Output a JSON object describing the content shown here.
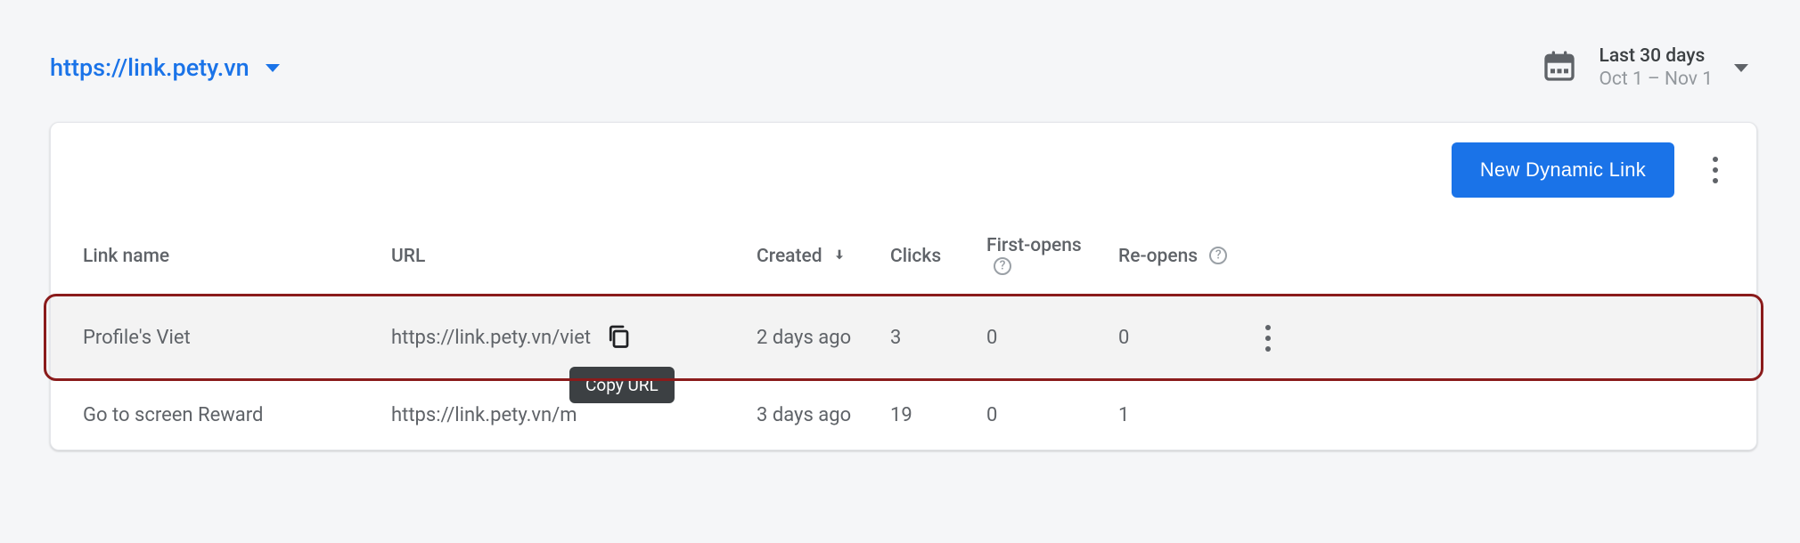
{
  "header": {
    "domain_label": "https://link.pety.vn",
    "date_range": {
      "label": "Last 30 days",
      "range": "Oct 1 – Nov 1"
    }
  },
  "toolbar": {
    "new_link_label": "New Dynamic Link"
  },
  "columns": {
    "name": "Link name",
    "url": "URL",
    "created": "Created",
    "clicks": "Clicks",
    "first_opens": "First-opens",
    "re_opens": "Re-opens"
  },
  "tooltip": {
    "copy_url": "Copy URL"
  },
  "rows": [
    {
      "name": "Profile's Viet",
      "url": "https://link.pety.vn/viet",
      "created": "2 days ago",
      "clicks": "3",
      "first_opens": "0",
      "re_opens": "0",
      "highlight": true,
      "show_copy": true,
      "show_actions": true,
      "url_truncated": false
    },
    {
      "name": "Go to screen Reward",
      "url": "https://link.pety.vn/m",
      "created": "3 days ago",
      "clicks": "19",
      "first_opens": "0",
      "re_opens": "1",
      "highlight": false,
      "show_copy": false,
      "show_actions": false,
      "url_truncated": true
    }
  ]
}
